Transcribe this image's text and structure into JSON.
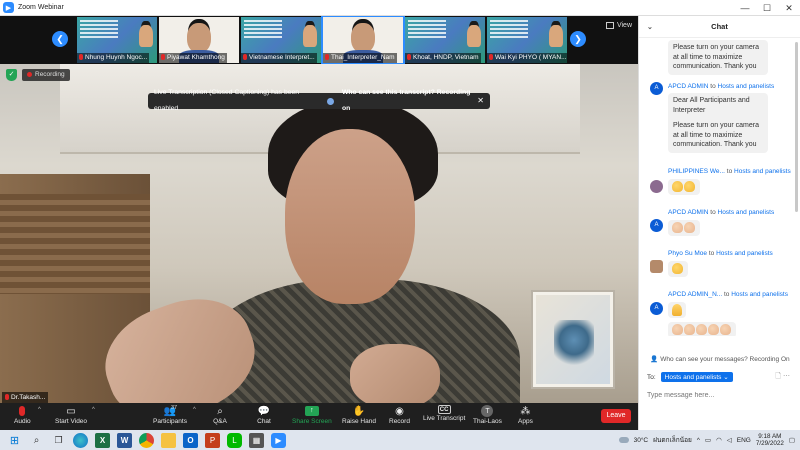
{
  "window": {
    "title": "Zoom Webinar",
    "controls": [
      "—",
      "☐",
      "✕"
    ]
  },
  "gallery": {
    "participants": [
      {
        "name": "Nhung Huynh Ngoc...",
        "muted": true
      },
      {
        "name": "Piyawat Khamthong",
        "muted": true
      },
      {
        "name": "Vietnamese Interpret...",
        "muted": true
      },
      {
        "name": "Thai_Interpreter_Nam",
        "muted": true
      },
      {
        "name": "Khoat, HNDP, Vietnam",
        "muted": true
      },
      {
        "name": "Wai Kyi PHYO ( MYAN...",
        "muted": true
      }
    ],
    "view_label": "View"
  },
  "recording_label": "Recording",
  "transcript_banner": {
    "text": "Live Transcription (Closed Captioning) has been enabled",
    "link": "Who can see this transcript? Recording on",
    "close": "✕"
  },
  "active_speaker": "Dr.Takash...",
  "toolbar": {
    "audio": "Audio",
    "video": "Start Video",
    "participants": "Participants",
    "participants_count": "37",
    "qa": "Q&A",
    "chat": "Chat",
    "share": "Share Screen",
    "raise_hand": "Raise Hand",
    "record": "Record",
    "live_transcript": "Live Transcript",
    "cc_icon": "CC",
    "language": "Thai-Laos",
    "language_icon": "T",
    "apps": "Apps",
    "leave": "Leave"
  },
  "chat": {
    "title": "Chat",
    "messages": [
      {
        "type": "text",
        "body": "Please turn on your camera at all time to maximize communication. Thank you"
      },
      {
        "type": "text",
        "sender": "APCD ADMIN",
        "to_word": "to",
        "recipient": "Hosts and panelists",
        "body_1": "Dear All Participants and Interpreter",
        "body_2": "Please turn on your camera at all time to maximize communication. Thank you"
      },
      {
        "type": "emoji",
        "sender": "PHILIPPINES We...",
        "to_word": "to",
        "recipient": "Hosts and panelists",
        "emoji": "clap-clap"
      },
      {
        "type": "emoji",
        "sender": "APCD ADMIN",
        "to_word": "to",
        "recipient": "Hosts and panelists",
        "emoji": "clap-clap-light"
      },
      {
        "type": "emoji",
        "sender": "Phyo Su Moe",
        "to_word": "to",
        "recipient": "Hosts and panelists",
        "emoji": "clap"
      },
      {
        "type": "emoji",
        "sender": "APCD ADMIN_N...",
        "to_word": "to",
        "recipient": "Hosts and panelists",
        "emoji": "pray",
        "emoji_2": "clap-x5"
      }
    ],
    "who_can_see": "Who can see your messages? Recording On",
    "to_label": "To:",
    "to_value": "Hosts and panelists",
    "input_placeholder": "Type message here..."
  },
  "taskbar": {
    "weather": "30°C",
    "location": "ฝนตกเล็กน้อย",
    "language": "ENG",
    "time": "9:18 AM",
    "date": "7/29/2022"
  }
}
